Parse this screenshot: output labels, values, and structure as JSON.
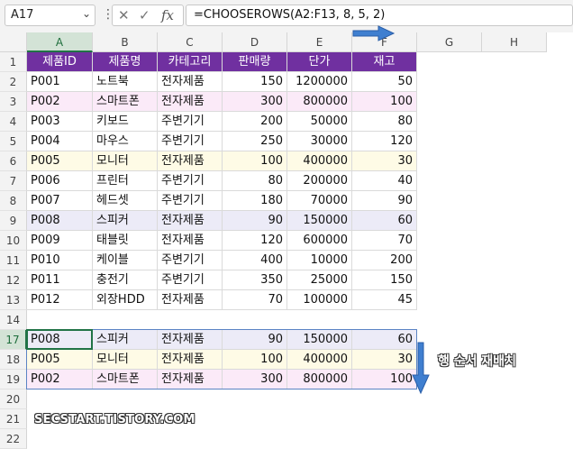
{
  "name_box": {
    "value": "A17"
  },
  "formula_bar": {
    "formula": "=CHOOSEROWS(A2:F13, 8, 5, 2)",
    "fx_label": "fx"
  },
  "columns": [
    "A",
    "B",
    "C",
    "D",
    "E",
    "F",
    "G",
    "H"
  ],
  "header_row": [
    "제품ID",
    "제품명",
    "카테고리",
    "판매량",
    "단가",
    "재고"
  ],
  "data_rows": [
    [
      "P001",
      "노트북",
      "전자제품",
      "150",
      "1200000",
      "50"
    ],
    [
      "P002",
      "스마트폰",
      "전자제품",
      "300",
      "800000",
      "100"
    ],
    [
      "P003",
      "키보드",
      "주변기기",
      "200",
      "50000",
      "80"
    ],
    [
      "P004",
      "마우스",
      "주변기기",
      "250",
      "30000",
      "120"
    ],
    [
      "P005",
      "모니터",
      "전자제품",
      "100",
      "400000",
      "30"
    ],
    [
      "P006",
      "프린터",
      "주변기기",
      "80",
      "200000",
      "40"
    ],
    [
      "P007",
      "헤드셋",
      "주변기기",
      "180",
      "70000",
      "90"
    ],
    [
      "P008",
      "스피커",
      "전자제품",
      "90",
      "150000",
      "60"
    ],
    [
      "P009",
      "태블릿",
      "전자제품",
      "120",
      "600000",
      "70"
    ],
    [
      "P010",
      "케이블",
      "주변기기",
      "400",
      "10000",
      "200"
    ],
    [
      "P011",
      "충전기",
      "주변기기",
      "350",
      "25000",
      "150"
    ],
    [
      "P012",
      "외장HDD",
      "전자제품",
      "70",
      "100000",
      "45"
    ]
  ],
  "result_rows": [
    [
      "P008",
      "스피커",
      "전자제품",
      "90",
      "150000",
      "60"
    ],
    [
      "P005",
      "모니터",
      "전자제품",
      "100",
      "400000",
      "30"
    ],
    [
      "P002",
      "스마트폰",
      "전자제품",
      "300",
      "800000",
      "100"
    ]
  ],
  "row_numbers": [
    "1",
    "2",
    "3",
    "4",
    "5",
    "6",
    "7",
    "8",
    "9",
    "10",
    "11",
    "12",
    "13",
    "14",
    "17",
    "18",
    "19",
    "20",
    "21",
    "22"
  ],
  "annotation": "행 순서 재배치",
  "watermark": "SECSTART.TISTORY.COM",
  "colors": {
    "header_bg": "#7030a0",
    "pink": "#fbeaf8",
    "yellow": "#fefbe6",
    "lavender": "#ecebf7",
    "arrow": "#3f7fd0",
    "selection": "#217346"
  }
}
